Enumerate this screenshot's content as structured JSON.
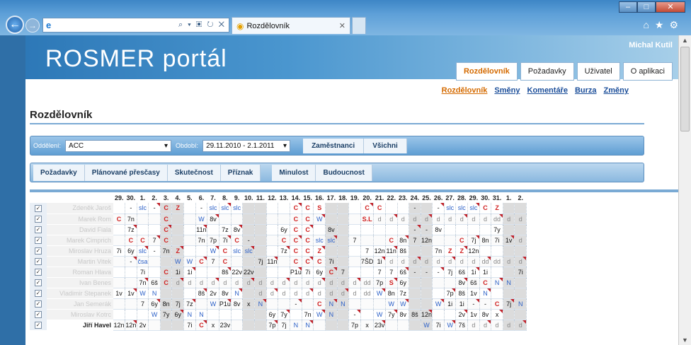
{
  "browser": {
    "address_text": "",
    "tab_title": "Rozdělovník",
    "minimize": "–",
    "maximize": "□",
    "close": "✕"
  },
  "header": {
    "logo": "ROSMER portál",
    "user": "Michal Kutil",
    "tabs": [
      "Rozdělovník",
      "Požadavky",
      "Uživatel",
      "O aplikaci"
    ],
    "active_tab": 0,
    "sub_links": [
      "Rozdělovník",
      "Směny",
      "Komentáře",
      "Burza",
      "Změny"
    ],
    "active_sub": 0
  },
  "page_title": "Rozdělovník",
  "filters": {
    "department_label": "Oddělení:",
    "department_value": "ACC",
    "period_label": "Období:",
    "period_value": "29.11.2010 - 2.1.2011",
    "buttons": [
      "Zaměstnanci",
      "Všichni"
    ]
  },
  "toolbar": {
    "group1": [
      "Požadavky",
      "Plánované přesčasy",
      "Skutečnost",
      "Příznak"
    ],
    "group2": [
      "Minulost",
      "Budoucnost"
    ]
  },
  "grid": {
    "days": [
      "29.",
      "30.",
      "1.",
      "2.",
      "3.",
      "4.",
      "5.",
      "6.",
      "7.",
      "8.",
      "9.",
      "10.",
      "11.",
      "12.",
      "13.",
      "14.",
      "15.",
      "16.",
      "17.",
      "18.",
      "19.",
      "20.",
      "21.",
      "22.",
      "23.",
      "24.",
      "25.",
      "26.",
      "27.",
      "28.",
      "29.",
      "30.",
      "31.",
      "1.",
      "2."
    ],
    "weekend_cols": [
      4,
      5,
      11,
      12,
      18,
      19,
      25,
      26,
      33,
      34
    ],
    "rows": [
      {
        "name": "Zdeněk Jaroš",
        "visible": false,
        "cells": [
          "",
          "-",
          "slc",
          "-",
          "C",
          "Z",
          "",
          "-",
          "slc",
          "slc",
          "slc",
          "",
          "",
          "",
          "",
          "C",
          "C",
          "S",
          "",
          "",
          "",
          "C",
          "C",
          "",
          "",
          "-",
          "",
          "-",
          "slc",
          "slc",
          "slc",
          "C",
          "Z",
          "",
          ""
        ]
      },
      {
        "name": "Marek Rom",
        "visible": false,
        "cells": [
          "C",
          "7n",
          "",
          "",
          "C",
          "",
          "",
          "W",
          "8v",
          "",
          "",
          "",
          "",
          "",
          "",
          "C",
          "C",
          "W",
          "",
          "",
          "",
          "S.L",
          "d",
          "d",
          "d",
          "d",
          "d",
          "d",
          "d",
          "d",
          "d",
          "d",
          "dd",
          "d",
          "d"
        ]
      },
      {
        "name": "David Fiala",
        "visible": false,
        "cells": [
          "",
          "7z",
          "",
          "",
          "C",
          "",
          "",
          "11n",
          "",
          "7z",
          "8v",
          "",
          "",
          "",
          "6y",
          "C",
          "C",
          "",
          "8v",
          "",
          "",
          "",
          "",
          "",
          "",
          "-",
          "-",
          "8v",
          "",
          "",
          "",
          "",
          "7y",
          "",
          ""
        ]
      },
      {
        "name": "Marek Cimprich",
        "visible": false,
        "cells": [
          "",
          "C",
          "C",
          "7",
          "C",
          "",
          "",
          "7n",
          "7p",
          "7i",
          "C",
          "-",
          "",
          "",
          "C",
          "C",
          "C",
          "slc",
          "slc",
          "",
          "7",
          "",
          "",
          "C",
          "8n",
          "7",
          "12n",
          "",
          "",
          "C",
          "7j",
          "8n",
          "7i",
          "1v",
          "d"
        ]
      },
      {
        "name": "Miroslav Hruza",
        "visible": false,
        "cells": [
          "7i",
          "6y",
          "slc",
          "-",
          "7n",
          "Z",
          "",
          "",
          "W",
          "C",
          "slc",
          "slc",
          "",
          "",
          "7z",
          "C",
          "C",
          "Z",
          "",
          "",
          "",
          "7",
          "12n",
          "11n",
          "8š",
          "",
          "",
          "7n",
          "Z",
          "Z",
          "12n",
          "",
          "",
          "",
          ""
        ]
      },
      {
        "name": "Martin Vitek",
        "visible": false,
        "cells": [
          "",
          "-",
          "čsa",
          "",
          "",
          "W",
          "W",
          "C",
          "7",
          "C",
          "",
          "",
          "7j",
          "11n",
          "",
          "C",
          "C",
          "C",
          "7i",
          "",
          "",
          "7ŠD",
          "1i",
          "d",
          "d",
          "d",
          "d",
          "d",
          "d",
          "d",
          "d",
          "dd",
          "dd",
          "d",
          "d"
        ]
      },
      {
        "name": "Roman Hlava",
        "visible": false,
        "cells": [
          "",
          "",
          "7i",
          "",
          "C",
          "1i",
          "1i",
          "",
          "",
          "8š",
          "22v",
          "22v",
          "",
          "",
          "",
          "P1u",
          "7i",
          "6y",
          "C",
          "7",
          "",
          "",
          "7",
          "7",
          "6š",
          "-",
          "-",
          "-",
          "7j",
          "6š",
          "1i",
          "1i",
          "",
          "",
          "7i"
        ]
      },
      {
        "name": "Ivan Benes",
        "visible": false,
        "cells": [
          "",
          "",
          "7n",
          "6š",
          "C",
          "d",
          "d",
          "d",
          "d",
          "d",
          "d",
          "d",
          "d",
          "d",
          "d",
          "d",
          "d",
          "d",
          "d",
          "d",
          "d",
          "dd",
          "7p",
          "S",
          "6y",
          "",
          "",
          "",
          "",
          "8v",
          "6š",
          "C",
          "N",
          "N",
          ""
        ]
      },
      {
        "name": "Vladimir Stepanek",
        "visible": false,
        "cells": [
          "1v",
          "1v",
          "W",
          "N",
          "",
          "",
          "",
          "8š",
          "2v",
          "8v",
          "N",
          "",
          "d",
          "d",
          "d",
          "d",
          "d",
          "d",
          "d",
          "d",
          "d",
          "dd",
          "W",
          "8n",
          "7z",
          "",
          "",
          "",
          "7p",
          "8š",
          "1v",
          "N",
          "",
          "",
          ""
        ]
      },
      {
        "name": "Jan Semerák",
        "visible": false,
        "cells": [
          "",
          "",
          "7",
          "6y",
          "8n",
          "7j",
          "7z",
          "",
          "W",
          "P1u",
          "8v",
          "x",
          "N",
          "",
          "",
          "-",
          "",
          "C",
          "N",
          "N",
          "",
          "",
          "",
          "W",
          "W",
          "",
          "",
          "W",
          "1i",
          "1i",
          "-",
          "-",
          "C",
          "7j",
          "N"
        ]
      },
      {
        "name": "Miroslav Kotrc",
        "visible": false,
        "cells": [
          "",
          "",
          "",
          "W",
          "7y",
          "6y",
          "N",
          "N",
          "",
          "",
          "",
          "",
          "",
          "6y",
          "7y",
          "",
          "7n",
          "W",
          "N",
          "",
          "-",
          "",
          "W",
          "7y",
          "8v",
          "8š",
          "12n",
          "",
          "",
          "2v",
          "1v",
          "8v",
          "x",
          "",
          ""
        ]
      },
      {
        "name": "Jiří Havel",
        "visible": true,
        "cells": [
          "12n",
          "12n",
          "2v",
          "",
          "",
          "",
          "7i",
          "C",
          "x",
          "23v",
          "",
          "",
          "",
          "7p",
          "7j",
          "N",
          "N",
          "",
          "",
          "",
          "7p",
          "x",
          "23v",
          "",
          "",
          "",
          "W",
          "7i",
          "W",
          "7š",
          "d",
          "d",
          "d",
          "d",
          "d"
        ]
      }
    ]
  },
  "colors": {
    "accent": "#d46a00",
    "link": "#1a4d99",
    "bar_top": "#9cc6e9",
    "bar_bottom": "#5f9ed3"
  }
}
